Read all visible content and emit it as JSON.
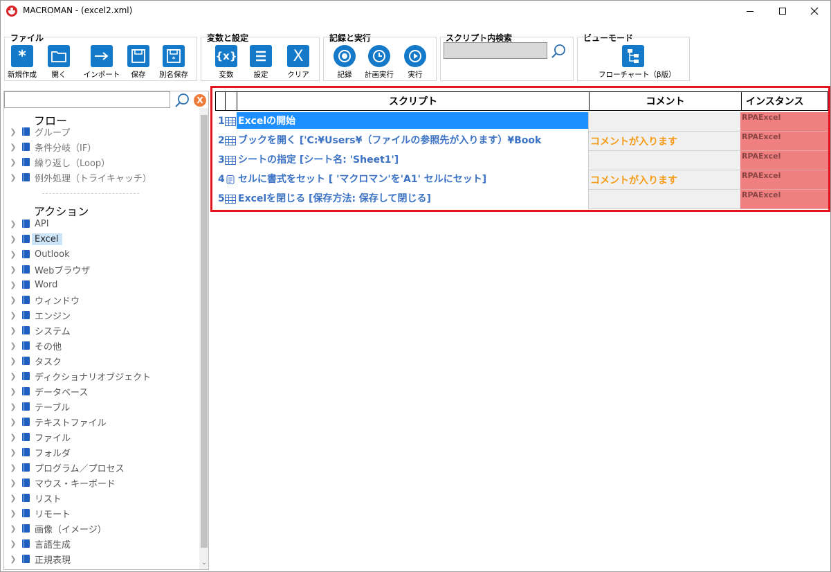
{
  "window": {
    "title": "MACROMAN - (excel2.xml)"
  },
  "ribbon": {
    "groups": [
      {
        "label": "ファイル",
        "buttons": [
          "新規作成",
          "開く",
          "インポート",
          "保存",
          "別名保存"
        ]
      },
      {
        "label": "変数と設定",
        "buttons": [
          "変数",
          "設定",
          "クリア"
        ]
      },
      {
        "label": "記録と実行",
        "buttons": [
          "記録",
          "計画実行",
          "実行"
        ]
      },
      {
        "label": "スクリプト内検索"
      },
      {
        "label": "ビューモード",
        "buttons": [
          "フローチャート（β版）"
        ]
      }
    ],
    "search_value": ""
  },
  "sidebar": {
    "search_value": "",
    "clear_label": "X",
    "flow_title": "フロー",
    "flow_items": [
      "グループ",
      "条件分岐（IF）",
      "繰り返し（Loop）",
      "例外処理（トライキャッチ）"
    ],
    "action_title": "アクション",
    "action_items": [
      "API",
      "Excel",
      "Outlook",
      "Webブラウザ",
      "Word",
      "ウィンドウ",
      "エンジン",
      "システム",
      "その他",
      "タスク",
      "ディクショナリオブジェクト",
      "データベース",
      "テーブル",
      "テキストファイル",
      "ファイル",
      "フォルダ",
      "プログラム／プロセス",
      "マウス・キーボード",
      "リスト",
      "リモート",
      "画像（イメージ）",
      "言語生成",
      "正規表現"
    ],
    "selected_action": "Excel"
  },
  "grid": {
    "headers": {
      "script": "スクリプト",
      "comment": "コメント",
      "instance": "インスタンス"
    },
    "rows": [
      {
        "num": "1",
        "script": "Excelの開始",
        "comment": "",
        "instance": "RPAExcel"
      },
      {
        "num": "2",
        "script": "ブックを開く ['C:¥Users¥（ファイルの参照先が入ります）¥Book",
        "comment": "コメントが入ります",
        "instance": "RPAExcel"
      },
      {
        "num": "3",
        "script": "シートの指定 [シート名: 'Sheet1']",
        "comment": "",
        "instance": "RPAExcel"
      },
      {
        "num": "4",
        "script": "セルに書式をセット [ 'マクロマン'を'A1' セルにセット]",
        "comment": "コメントが入ります",
        "instance": "RPAExcel"
      },
      {
        "num": "5",
        "script": "Excelを閉じる [保存方法: 保存して閉じる]",
        "comment": "",
        "instance": "RPAExcel"
      }
    ]
  },
  "colors": {
    "accent": "#1479c8",
    "selection": "#1e8fff",
    "comment_text": "#f59b14",
    "instance_bg": "#f08080",
    "highlight_frame": "#e3141c"
  }
}
